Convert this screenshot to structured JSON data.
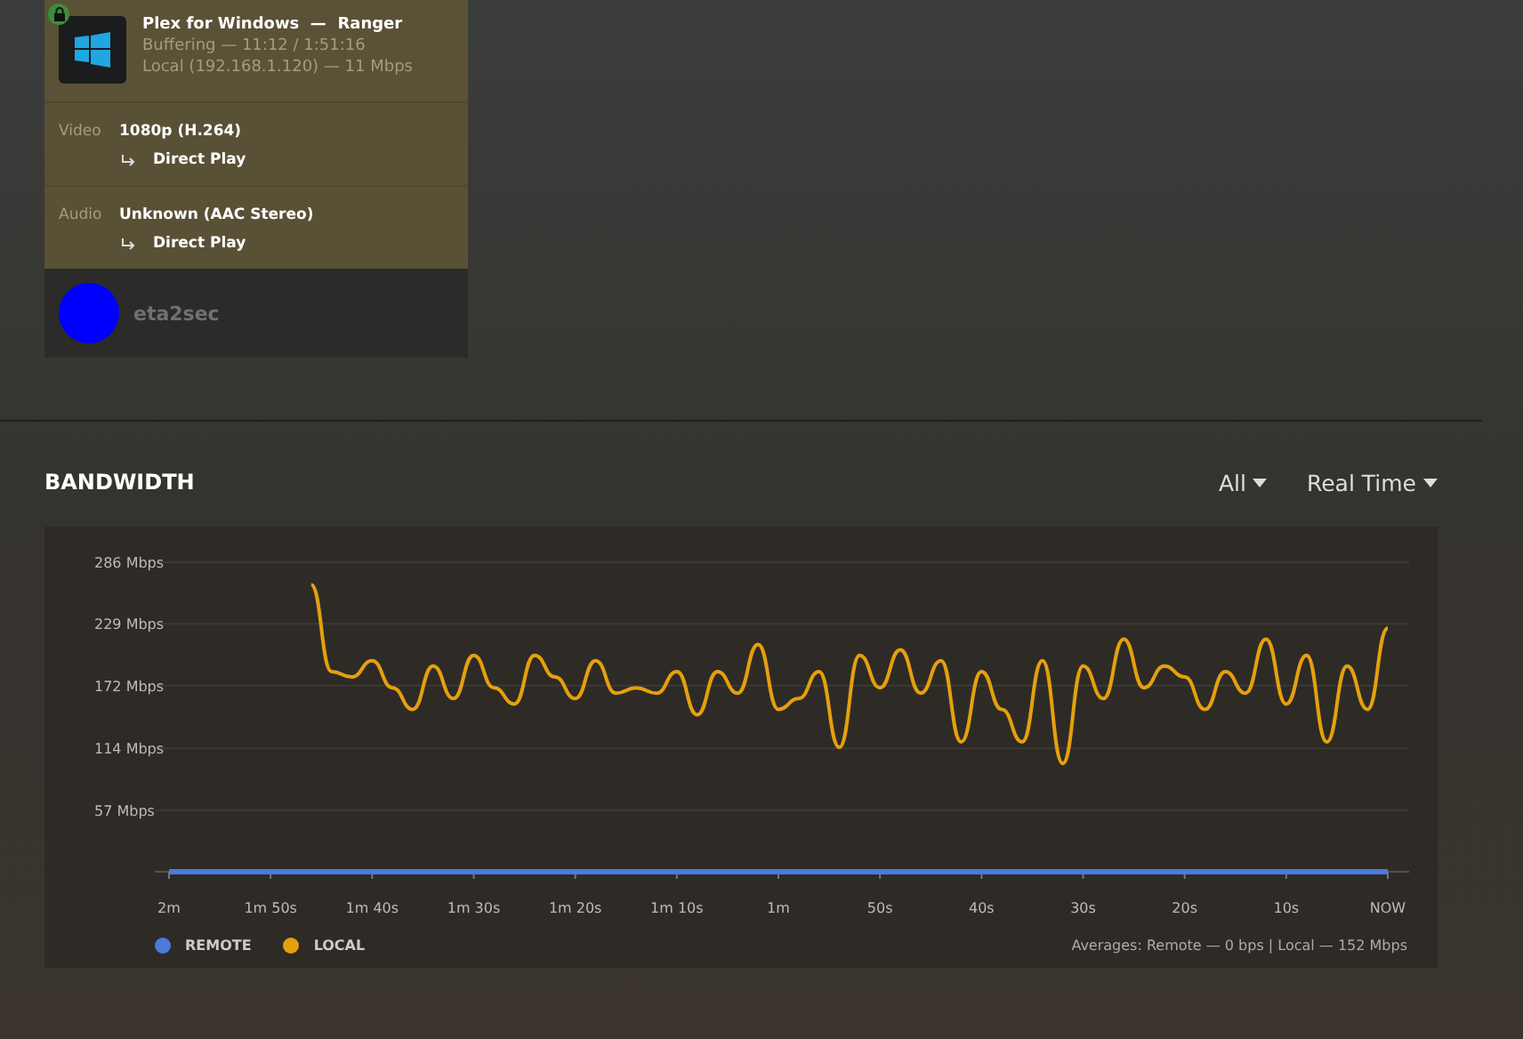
{
  "session_card": {
    "locked": true,
    "title": "Plex for Windows",
    "separator": "—",
    "user": "Ranger",
    "status": "Buffering — 11:12 / 1:51:16",
    "network": "Local (192.168.1.120) — 11 Mbps",
    "streams": [
      {
        "label": "Video",
        "value": "1080p (H.264)",
        "decision": "Direct Play"
      },
      {
        "label": "Audio",
        "value": "Unknown (AAC Stereo)",
        "decision": "Direct Play"
      }
    ],
    "player": {
      "name": "eta2sec",
      "color": "#0000ff"
    }
  },
  "bandwidth": {
    "title": "BANDWIDTH",
    "filters": [
      "All",
      "Real Time"
    ],
    "averages": "Averages: Remote — 0 bps | Local — 152 Mbps",
    "chart_data": {
      "type": "line",
      "ylim": [
        0,
        286
      ],
      "grid": true,
      "categories": [
        "2m",
        null,
        null,
        null,
        null,
        "1m 50s",
        null,
        null,
        null,
        null,
        "1m 40s",
        null,
        null,
        null,
        null,
        "1m 30s",
        null,
        null,
        null,
        null,
        "1m 20s",
        null,
        null,
        null,
        null,
        "1m 10s",
        null,
        null,
        null,
        null,
        "1m",
        null,
        null,
        null,
        null,
        "50s",
        null,
        null,
        null,
        null,
        "40s",
        null,
        null,
        null,
        null,
        "30s",
        null,
        null,
        null,
        null,
        "20s",
        null,
        null,
        null,
        null,
        "10s",
        null,
        null,
        null,
        null,
        "NOW"
      ],
      "yticks": [
        {
          "value": 57,
          "label": "57 Mbps"
        },
        {
          "value": 114,
          "label": "114 Mbps"
        },
        {
          "value": 172,
          "label": "172 Mbps"
        },
        {
          "value": 229,
          "label": "229 Mbps"
        },
        {
          "value": 286,
          "label": "286 Mbps"
        }
      ],
      "series": [
        {
          "name": "REMOTE",
          "color": "#4c7bd9",
          "values": [
            0,
            0,
            0,
            0,
            0,
            0,
            0,
            0,
            0,
            0,
            0,
            0,
            0,
            0,
            0,
            0,
            0,
            0,
            0,
            0,
            0,
            0,
            0,
            0,
            0,
            0,
            0,
            0,
            0,
            0,
            0,
            0,
            0,
            0,
            0,
            0,
            0,
            0,
            0,
            0,
            0,
            0,
            0,
            0,
            0,
            0,
            0,
            0,
            0,
            0,
            0,
            0,
            0,
            0,
            0,
            0,
            0,
            0,
            0,
            0,
            0
          ]
        },
        {
          "name": "LOCAL",
          "color": "#e5a00d",
          "values": [
            null,
            null,
            null,
            null,
            null,
            null,
            null,
            265,
            185,
            180,
            195,
            170,
            150,
            190,
            160,
            200,
            170,
            155,
            200,
            180,
            160,
            195,
            165,
            170,
            165,
            185,
            145,
            185,
            165,
            210,
            150,
            160,
            185,
            115,
            200,
            170,
            205,
            165,
            195,
            120,
            185,
            150,
            120,
            195,
            100,
            190,
            160,
            215,
            170,
            190,
            180,
            150,
            185,
            165,
            215,
            155,
            200,
            120,
            190,
            150,
            225
          ]
        }
      ]
    }
  }
}
